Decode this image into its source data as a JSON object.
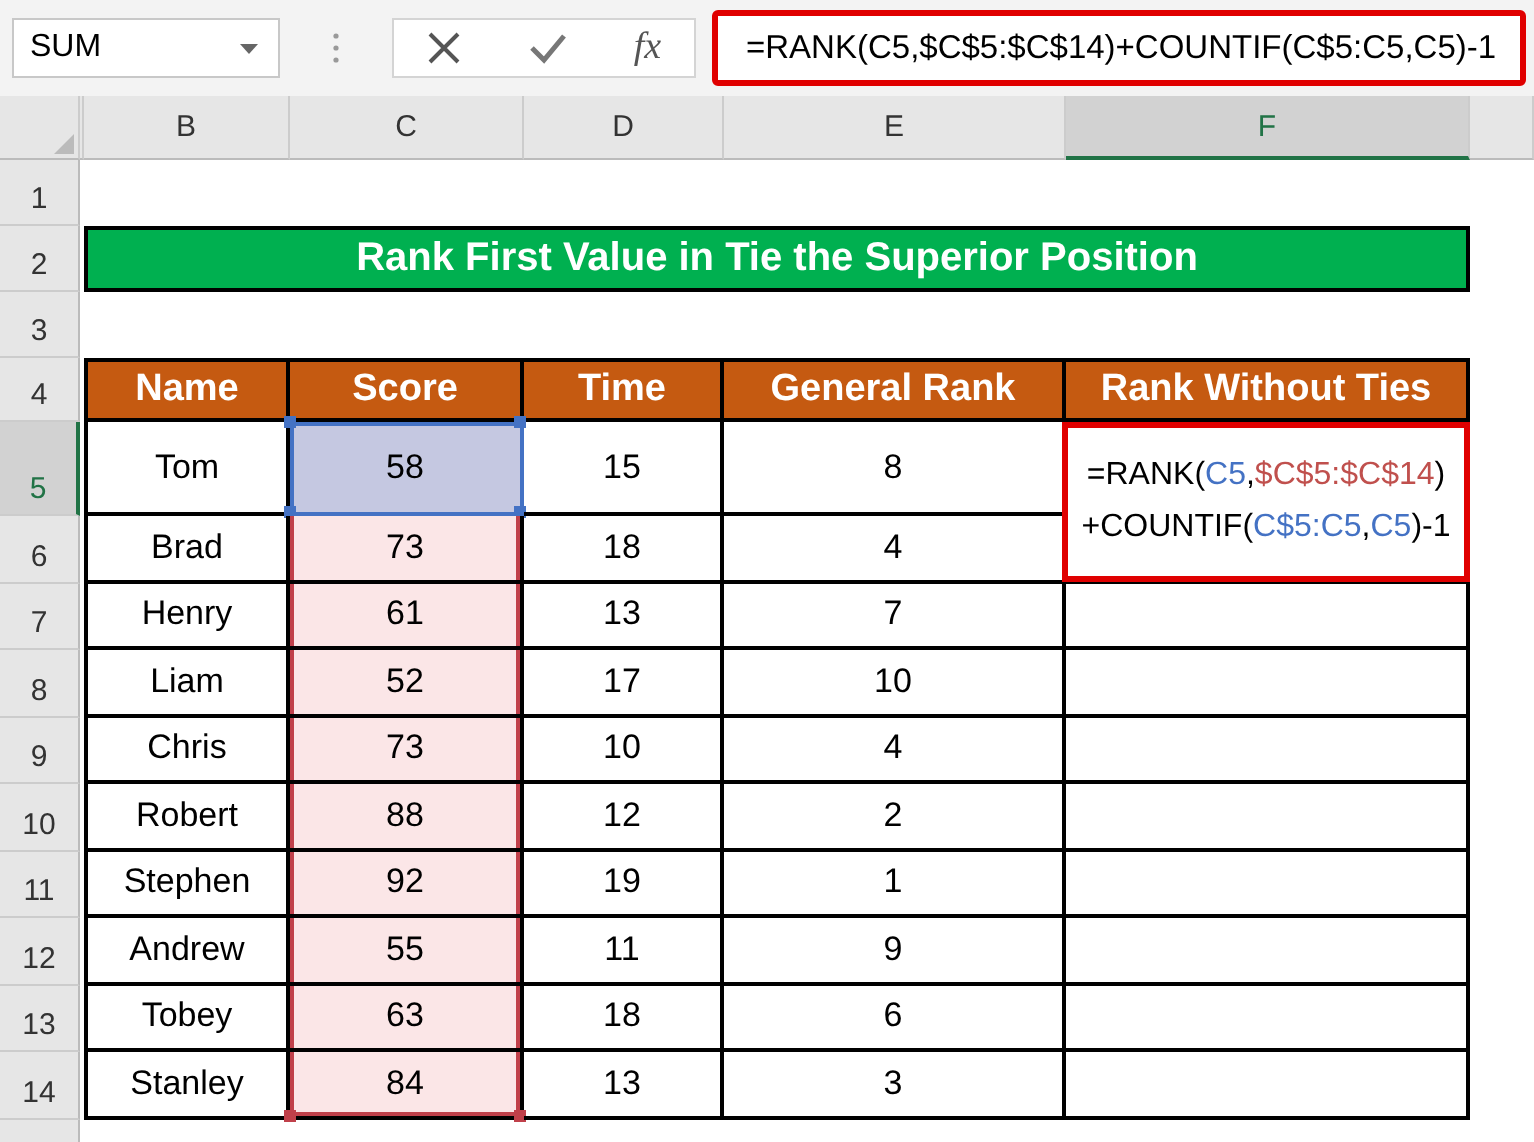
{
  "name_box": {
    "value": "SUM"
  },
  "formula_bar": {
    "fx_label": "fx",
    "value": "=RANK(C5,$C$5:$C$14)+COUNTIF(C$5:C5,C5)-1"
  },
  "columns": [
    {
      "label": "B",
      "selected": false
    },
    {
      "label": "C",
      "selected": false
    },
    {
      "label": "D",
      "selected": false
    },
    {
      "label": "E",
      "selected": false
    },
    {
      "label": "F",
      "selected": true
    }
  ],
  "row_numbers": [
    {
      "label": "1",
      "selected": false
    },
    {
      "label": "2",
      "selected": false
    },
    {
      "label": "3",
      "selected": false
    },
    {
      "label": "4",
      "selected": false
    },
    {
      "label": "5",
      "selected": true
    },
    {
      "label": "6",
      "selected": false
    },
    {
      "label": "7",
      "selected": false
    },
    {
      "label": "8",
      "selected": false
    },
    {
      "label": "9",
      "selected": false
    },
    {
      "label": "10",
      "selected": false
    },
    {
      "label": "11",
      "selected": false
    },
    {
      "label": "12",
      "selected": false
    },
    {
      "label": "13",
      "selected": false
    },
    {
      "label": "14",
      "selected": false
    }
  ],
  "title": "Rank First Value in Tie the Superior Position",
  "headers": [
    "Name",
    "Score",
    "Time",
    "General Rank",
    "Rank Without Ties"
  ],
  "rows": [
    {
      "name": "Tom",
      "score": "58",
      "time": "15",
      "general_rank": "8",
      "score_selected": true,
      "score_in_range": false,
      "formula_lines": [
        [
          {
            "text": "=RANK(",
            "color": "#000000"
          },
          {
            "text": "C5",
            "color": "#4472c4"
          },
          {
            "text": ",",
            "color": "#000000"
          },
          {
            "text": "$C$5:$C$14",
            "color": "#c0504d"
          },
          {
            "text": ")",
            "color": "#000000"
          }
        ],
        [
          {
            "text": "+COUNTIF(",
            "color": "#000000"
          },
          {
            "text": "C$5:C5",
            "color": "#4472c4"
          },
          {
            "text": ",",
            "color": "#000000"
          },
          {
            "text": "C5",
            "color": "#4472c4"
          },
          {
            "text": ")-1",
            "color": "#000000"
          }
        ]
      ]
    },
    {
      "name": "Brad",
      "score": "73",
      "time": "18",
      "general_rank": "4",
      "score_selected": false,
      "score_in_range": true
    },
    {
      "name": "Henry",
      "score": "61",
      "time": "13",
      "general_rank": "7",
      "score_selected": false,
      "score_in_range": true
    },
    {
      "name": "Liam",
      "score": "52",
      "time": "17",
      "general_rank": "10",
      "score_selected": false,
      "score_in_range": true
    },
    {
      "name": "Chris",
      "score": "73",
      "time": "10",
      "general_rank": "4",
      "score_selected": false,
      "score_in_range": true
    },
    {
      "name": "Robert",
      "score": "88",
      "time": "12",
      "general_rank": "2",
      "score_selected": false,
      "score_in_range": true
    },
    {
      "name": "Stephen",
      "score": "92",
      "time": "19",
      "general_rank": "1",
      "score_selected": false,
      "score_in_range": true
    },
    {
      "name": "Andrew",
      "score": "55",
      "time": "11",
      "general_rank": "9",
      "score_selected": false,
      "score_in_range": true
    },
    {
      "name": "Tobey",
      "score": "63",
      "time": "18",
      "general_rank": "6",
      "score_selected": false,
      "score_in_range": true
    },
    {
      "name": "Stanley",
      "score": "84",
      "time": "13",
      "general_rank": "3",
      "score_selected": false,
      "score_in_range": true
    }
  ]
}
